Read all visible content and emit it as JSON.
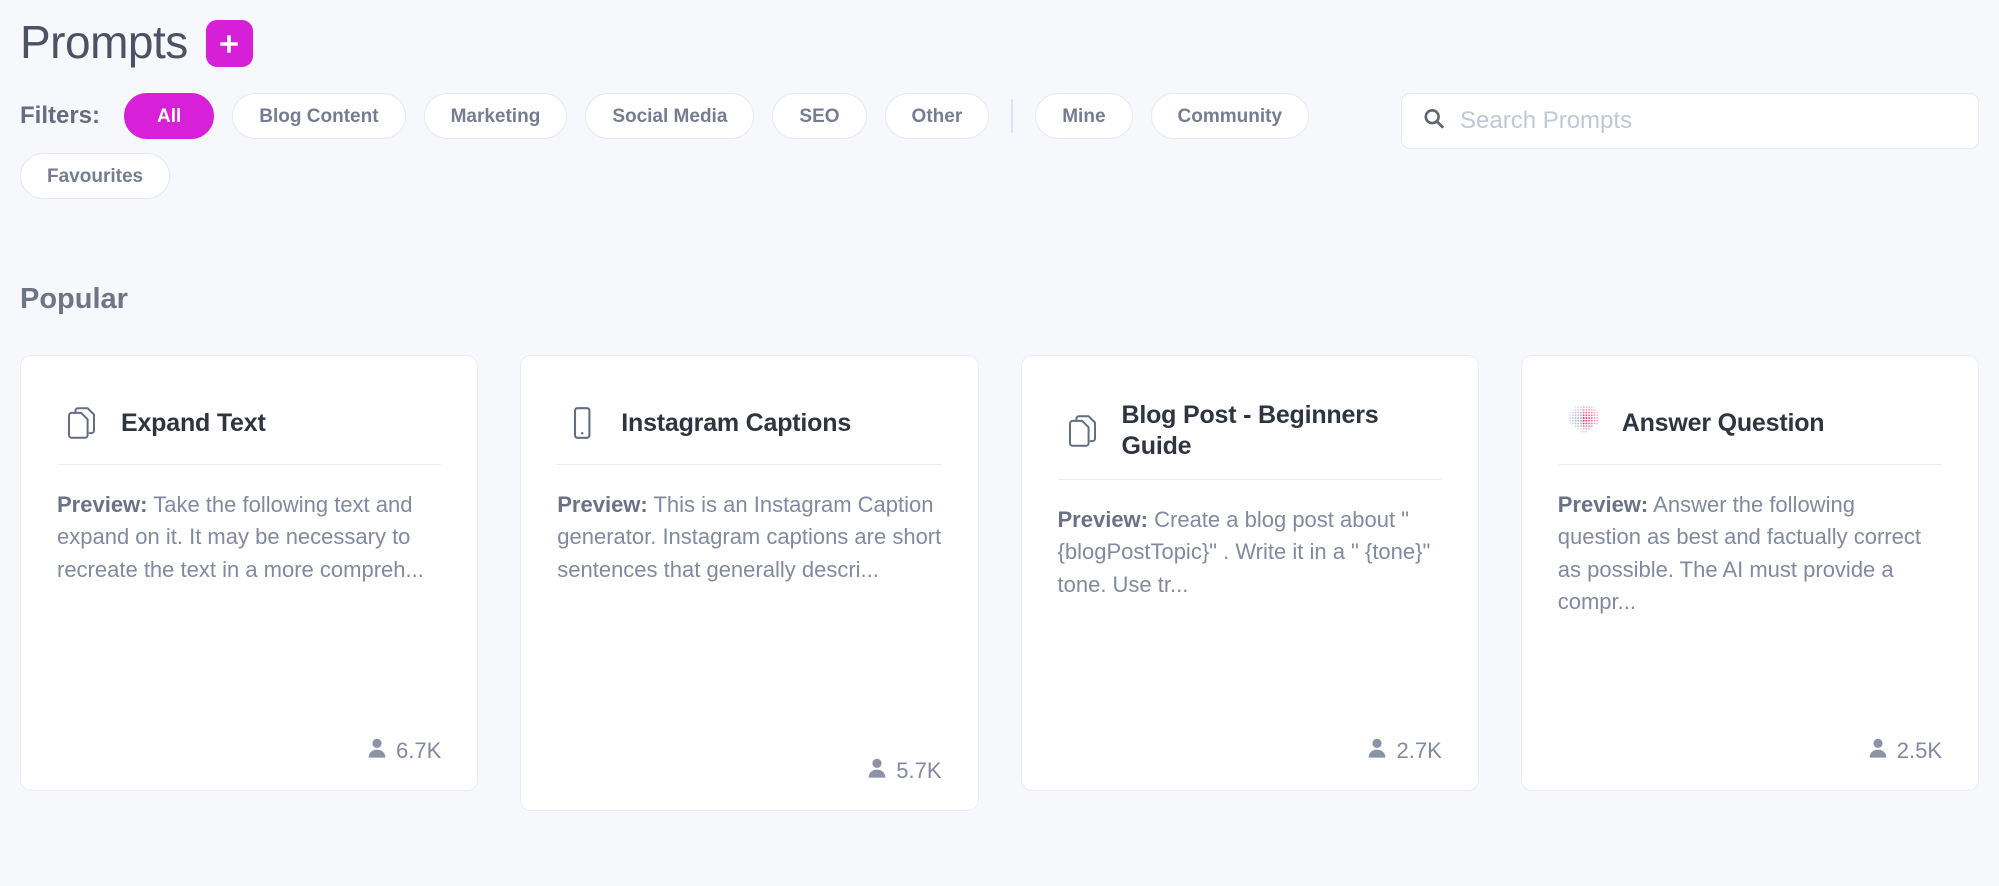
{
  "header": {
    "title": "Prompts",
    "add_button_label": "+",
    "add_button_icon": "plus-icon",
    "accent_color": "#d81fd8"
  },
  "filters": {
    "label": "Filters:",
    "chips": [
      {
        "label": "All",
        "active": true
      },
      {
        "label": "Blog Content",
        "active": false
      },
      {
        "label": "Marketing",
        "active": false
      },
      {
        "label": "Social Media",
        "active": false
      },
      {
        "label": "SEO",
        "active": false
      },
      {
        "label": "Other",
        "active": false
      }
    ],
    "chips_after_divider": [
      {
        "label": "Mine",
        "active": false
      },
      {
        "label": "Community",
        "active": false
      },
      {
        "label": "Favourites",
        "active": false
      }
    ]
  },
  "search": {
    "placeholder": "Search Prompts",
    "value": "",
    "icon": "search-icon"
  },
  "sections": [
    {
      "title": "Popular"
    }
  ],
  "cards": [
    {
      "icon": "copy-documents-icon",
      "title": "Expand Text",
      "preview_label": "Preview:",
      "preview_text": "Take the following text and expand on it. It may be necessary to recreate the text in a more compreh...",
      "count": "6.7K",
      "count_icon": "user-icon"
    },
    {
      "icon": "mobile-phone-icon",
      "title": "Instagram Captions",
      "preview_label": "Preview:",
      "preview_text": "This is an Instagram Caption generator. Instagram captions are short sentences that generally descri...",
      "count": "5.7K",
      "count_icon": "user-icon"
    },
    {
      "icon": "copy-documents-icon",
      "title": "Blog Post - Beginners Guide",
      "preview_label": "Preview:",
      "preview_text": "Create a blog post about \" {blogPostTopic}\" . Write it in a \" {tone}\" tone. Use tr...",
      "count": "2.7K",
      "count_icon": "user-icon"
    },
    {
      "icon": "halftone-logo-icon",
      "title": "Answer Question",
      "preview_label": "Preview:",
      "preview_text": "Answer the following question as best and factually correct as possible. The AI must provide a compr...",
      "count": "2.5K",
      "count_icon": "user-icon"
    }
  ]
}
